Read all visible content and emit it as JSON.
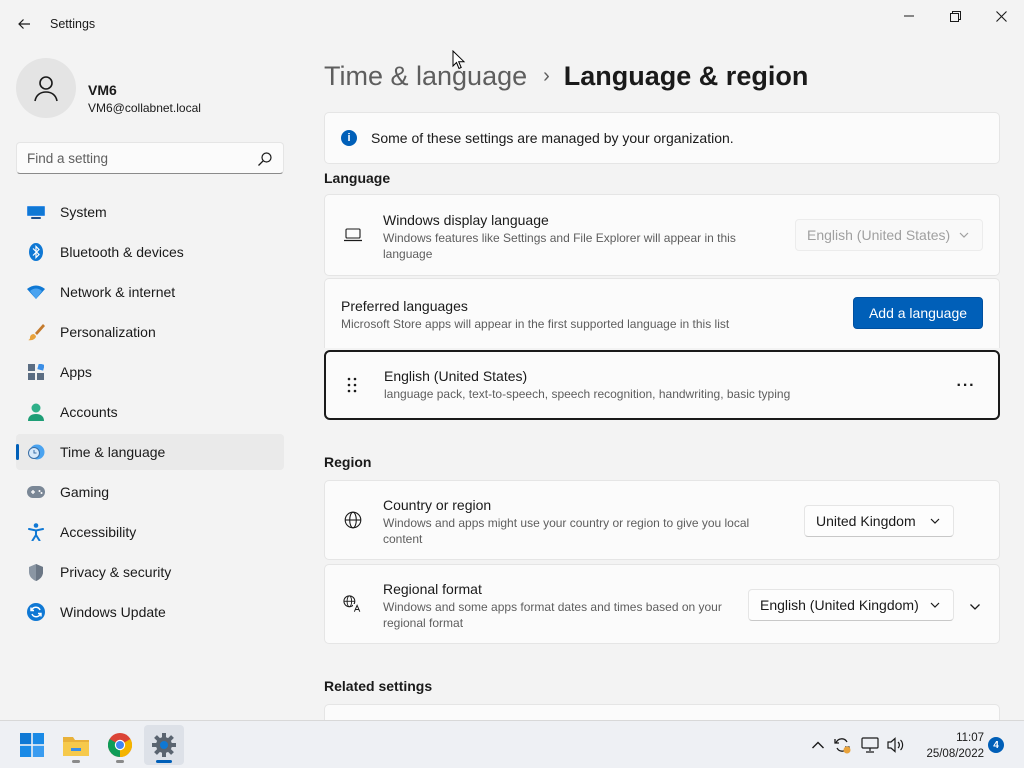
{
  "window": {
    "title": "Settings"
  },
  "profile": {
    "name": "VM6",
    "email": "VM6@collabnet.local"
  },
  "search": {
    "placeholder": "Find a setting"
  },
  "nav": [
    {
      "label": "System",
      "icon": "monitor-icon",
      "active": false
    },
    {
      "label": "Bluetooth & devices",
      "icon": "bluetooth-icon",
      "active": false
    },
    {
      "label": "Network & internet",
      "icon": "wifi-icon",
      "active": false
    },
    {
      "label": "Personalization",
      "icon": "paintbrush-icon",
      "active": false
    },
    {
      "label": "Apps",
      "icon": "apps-icon",
      "active": false
    },
    {
      "label": "Accounts",
      "icon": "person-icon",
      "active": false
    },
    {
      "label": "Time & language",
      "icon": "clock-globe-icon",
      "active": true
    },
    {
      "label": "Gaming",
      "icon": "gamepad-icon",
      "active": false
    },
    {
      "label": "Accessibility",
      "icon": "accessibility-icon",
      "active": false
    },
    {
      "label": "Privacy & security",
      "icon": "shield-icon",
      "active": false
    },
    {
      "label": "Windows Update",
      "icon": "update-icon",
      "active": false
    }
  ],
  "breadcrumb": {
    "parent": "Time & language",
    "separator": "›",
    "current": "Language & region"
  },
  "info_banner": {
    "text": "Some of these settings are managed by your organization."
  },
  "language_section": {
    "title": "Language",
    "display_language": {
      "title": "Windows display language",
      "description": "Windows features like Settings and File Explorer will appear in this language",
      "value": "English (United States)"
    },
    "preferred": {
      "title": "Preferred languages",
      "description": "Microsoft Store apps will appear in the first supported language in this list",
      "button_label": "Add a language"
    },
    "installed": [
      {
        "name": "English (United States)",
        "features": "language pack, text-to-speech, speech recognition, handwriting, basic typing",
        "more_label": "···"
      }
    ]
  },
  "region_section": {
    "title": "Region",
    "country": {
      "title": "Country or region",
      "description": "Windows and apps might use your country or region to give you local content",
      "value": "United Kingdom"
    },
    "format": {
      "title": "Regional format",
      "description": "Windows and some apps format dates and times based on your regional format",
      "value": "English (United Kingdom)"
    }
  },
  "related": {
    "title": "Related settings"
  },
  "taskbar": {
    "time": "11:07",
    "date": "25/08/2022",
    "notification_count": "4"
  },
  "colors": {
    "accent": "#005fb8",
    "background": "#f3f3f3",
    "card": "#fbfbfb"
  }
}
